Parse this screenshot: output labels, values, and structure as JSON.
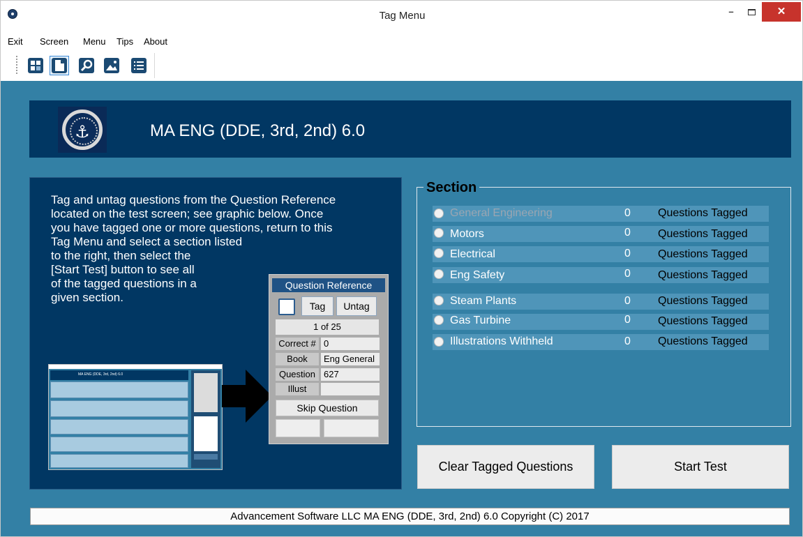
{
  "window": {
    "title": "Tag Menu",
    "minimize_glyph": "–",
    "close_glyph": "✕"
  },
  "menu": [
    "Exit",
    "Screen",
    "Menu",
    "Tips",
    "About"
  ],
  "toolbar": {
    "icons": [
      "calculator-icon",
      "document-icon",
      "search-icon",
      "image-icon",
      "list-icon"
    ],
    "active_index": 1
  },
  "banner": {
    "title": "MA ENG (DDE, 3rd, 2nd) 6.0",
    "logo_glyph": "⚓"
  },
  "instructions": [
    "Tag and untag questions from the Question Reference",
    "located on the test screen; see graphic below. Once",
    "you have tagged one or more questions, return to this",
    "Tag Menu  and select a section listed",
    "to the right, then select the",
    "[Start Test] button to see all",
    "of the tagged questions in a",
    "given section."
  ],
  "question_reference": {
    "title": "Question Reference",
    "tag_label": "Tag",
    "untag_label": "Untag",
    "count": "1  of  25",
    "fields": [
      {
        "label": "Correct #",
        "value": "0"
      },
      {
        "label": "Book",
        "value": "Eng General"
      },
      {
        "label": "Question",
        "value": "627"
      },
      {
        "label": "Illust",
        "value": ""
      }
    ],
    "skip_label": "Skip Question"
  },
  "section": {
    "title": "Section",
    "rows": [
      {
        "name": "General Engineering",
        "count": "0",
        "label": "Questions Tagged"
      },
      {
        "name": "Motors",
        "count": "0",
        "label": "Questions Tagged"
      },
      {
        "name": "Electrical",
        "count": "0",
        "label": "Questions Tagged"
      },
      {
        "name": "Eng Safety",
        "count": "0",
        "label": "Questions Tagged"
      },
      {
        "name": "Steam Plants",
        "count": "0",
        "label": "Questions Tagged"
      },
      {
        "name": "Gas Turbine",
        "count": "0",
        "label": "Questions Tagged"
      },
      {
        "name": "Illustrations Withheld",
        "count": "0",
        "label": "Questions Tagged"
      }
    ],
    "colors": {
      "first_item_text": "#9aa6b2",
      "item_text": "#ffffff",
      "count_text": "#ffffff",
      "tag_text": "#000000"
    }
  },
  "buttons": {
    "clear": "Clear Tagged Questions",
    "start": "Start Test"
  },
  "status": "Advancement Software LLC MA ENG (DDE, 3rd, 2nd) 6.0 Copyright (C) 2017",
  "colors": {
    "background": "#3380a5",
    "navy": "#013763",
    "close_button": "#c7332c"
  }
}
